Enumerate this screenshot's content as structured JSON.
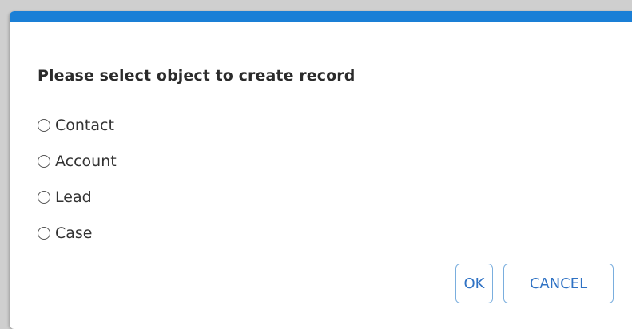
{
  "dialog": {
    "title": "Please select object to create record",
    "accent_color": "#1a7fd6",
    "options": [
      {
        "label": "Contact",
        "selected": false
      },
      {
        "label": "Account",
        "selected": false
      },
      {
        "label": "Lead",
        "selected": false
      },
      {
        "label": "Case",
        "selected": false
      }
    ],
    "buttons": {
      "ok_label": "OK",
      "cancel_label": "CANCEL",
      "button_text_color": "#2f72c4",
      "button_border_color": "#7aaede"
    }
  }
}
